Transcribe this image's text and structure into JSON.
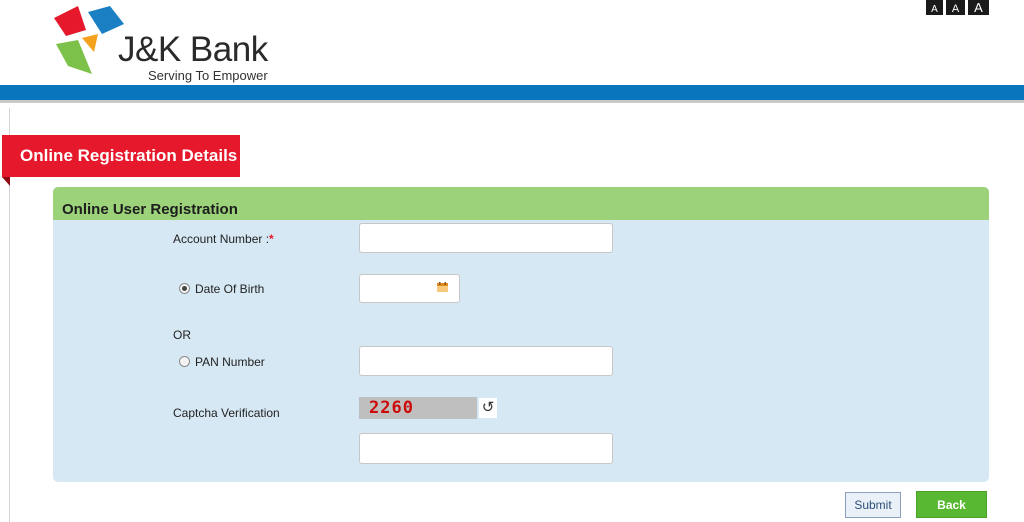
{
  "header": {
    "brand_name": "J&K Bank",
    "tagline": "Serving To Empower",
    "font_size_controls": [
      "A",
      "A",
      "A"
    ]
  },
  "section": {
    "title": "Online Registration Details"
  },
  "panel": {
    "title": "Online User Registration",
    "account_number_label": "Account Number :",
    "required_marker": "*",
    "dob_label": "Date Of Birth",
    "or_label": "OR",
    "pan_label": "PAN Number",
    "captcha_label": "Captcha Verification",
    "captcha_code": "2260",
    "refresh_glyph": "↺",
    "account_number_value": "",
    "dob_value": "",
    "pan_value": "",
    "captcha_value": "",
    "selected_option": "Date Of Birth"
  },
  "actions": {
    "submit_label": "Submit",
    "back_label": "Back"
  },
  "colors": {
    "brand_blue": "#0875bd",
    "ribbon_red": "#e5192b",
    "panel_header_green": "#9bd27a",
    "panel_bg": "#d6e8f4",
    "back_button_green": "#58b832"
  },
  "icons": [
    "jk-bank-logo-icon",
    "calendar-icon",
    "refresh-icon"
  ]
}
